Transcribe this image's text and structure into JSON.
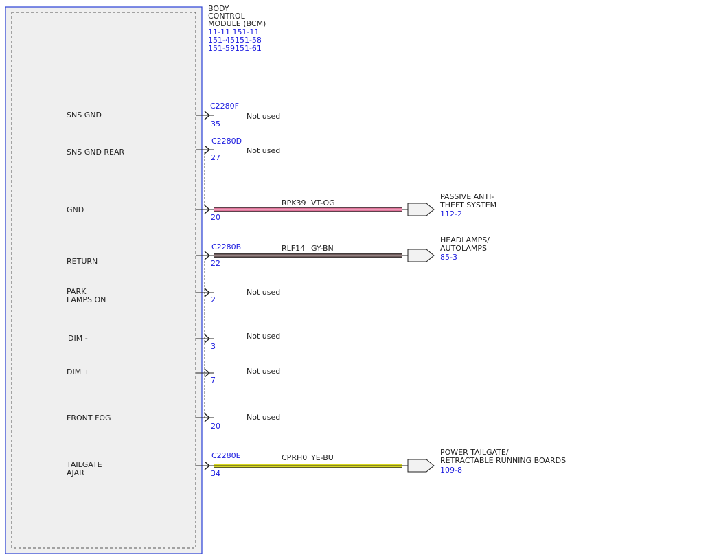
{
  "module": {
    "title_lines": [
      "BODY",
      "CONTROL",
      "MODULE (BCM)"
    ],
    "refs": [
      "11-11  151-11",
      "151-45151-58",
      "151-59151-61"
    ]
  },
  "pins": [
    {
      "id": "sns-gnd",
      "label_lines": [
        "SNS GND"
      ],
      "connector": "C2280F",
      "pin": "35",
      "status": "Not used"
    },
    {
      "id": "sns-gnd-rear",
      "label_lines": [
        "SNS GND REAR"
      ],
      "connector": "C2280D",
      "pin": "27",
      "status": "Not used"
    },
    {
      "id": "gnd",
      "label_lines": [
        "GND"
      ],
      "connector": "",
      "pin": "20",
      "status": "",
      "wire": {
        "circuit": "RPK39",
        "color": "VT-OG",
        "main": "#e0749a",
        "stripe": "#f0b0c8"
      },
      "dest": {
        "lines": [
          "PASSIVE ANTI-",
          "THEFT SYSTEM"
        ],
        "ref": "112-2"
      }
    },
    {
      "id": "return",
      "label_lines": [
        "RETURN"
      ],
      "connector": "C2280B",
      "pin": "22",
      "status": "",
      "wire": {
        "circuit": "RLF14",
        "color": "GY-BN",
        "main": "#6e5a5a",
        "stripe": "#a89a9a"
      },
      "dest": {
        "lines": [
          "HEADLAMPS/",
          "AUTOLAMPS"
        ],
        "ref": "85-3"
      }
    },
    {
      "id": "park-lamps-on",
      "label_lines": [
        "PARK",
        "LAMPS ON"
      ],
      "connector": "",
      "pin": "2",
      "status": "Not used"
    },
    {
      "id": "dim-minus",
      "label_lines": [
        "DIM -"
      ],
      "connector": "",
      "pin": "3",
      "status": "Not used"
    },
    {
      "id": "dim-plus",
      "label_lines": [
        "DIM +"
      ],
      "connector": "",
      "pin": "7",
      "status": "Not used"
    },
    {
      "id": "front-fog",
      "label_lines": [
        "FRONT FOG"
      ],
      "connector": "",
      "pin": "20",
      "status": "Not used"
    },
    {
      "id": "tailgate-ajar",
      "label_lines": [
        "TAILGATE",
        "AJAR"
      ],
      "connector": "C2280E",
      "pin": "34",
      "status": "",
      "wire": {
        "circuit": "CPRH0",
        "color": "YE-BU",
        "main": "#d8d820",
        "stripe": "#5a5a20"
      },
      "dest": {
        "lines": [
          "POWER TAILGATE/",
          "RETRACTABLE RUNNING BOARDS"
        ],
        "ref": "109-8"
      }
    }
  ],
  "colors": {
    "module_border": "#2a3fd6",
    "ref_text": "#1a1adf",
    "module_fill": "#efefef"
  }
}
